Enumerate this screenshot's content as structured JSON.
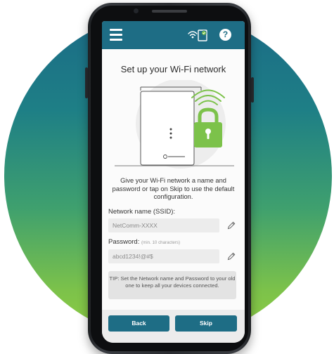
{
  "app": {
    "screen_title": "Set up your Wi-Fi network",
    "description": "Give your Wi-Fi network a name and password or tap on Skip to use the default configuration.",
    "help_label": "?"
  },
  "form": {
    "ssid_label": "Network name (SSID):",
    "ssid_value": "NetComm-XXXX",
    "password_label": "Password:",
    "password_hint": "(min. 10 characters)",
    "password_value": "abcd1234!@#$"
  },
  "tip": {
    "text": "TIP: Set the Network name and Password to your old one to keep all your devices connected."
  },
  "buttons": {
    "back": "Back",
    "skip": "Skip"
  },
  "colors": {
    "accent": "#1e6d85",
    "lock_green": "#7cc24a",
    "circle_top": "#1b6a86",
    "circle_bottom": "#8fcd42"
  },
  "icons": [
    "menu-icon",
    "wifi-device-status-icon",
    "help-icon",
    "lock-icon",
    "pencil-icon"
  ]
}
